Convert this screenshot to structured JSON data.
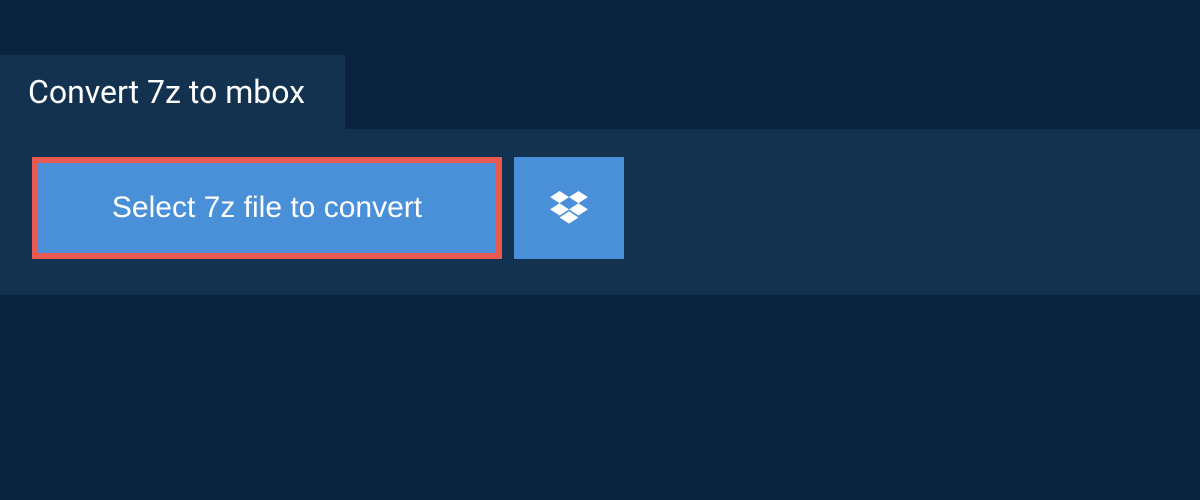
{
  "header": {
    "title": "Convert 7z to mbox"
  },
  "actions": {
    "select_file_label": "Select 7z file to convert",
    "dropbox_icon": "dropbox-icon"
  },
  "colors": {
    "background": "#0a2440",
    "panel": "#13324f",
    "button": "#4a90d9",
    "highlight_border": "#e85a4f",
    "text": "#ffffff"
  }
}
